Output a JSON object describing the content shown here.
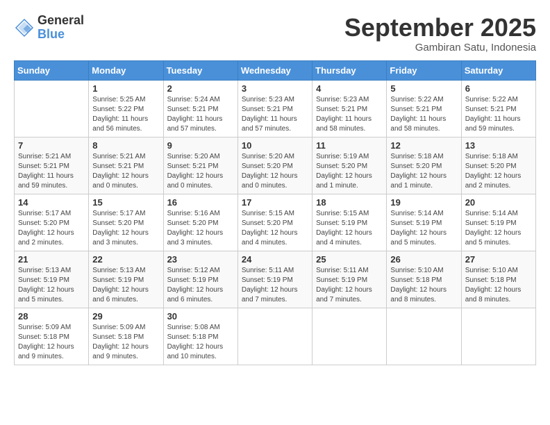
{
  "logo": {
    "general": "General",
    "blue": "Blue"
  },
  "title": "September 2025",
  "location": "Gambiran Satu, Indonesia",
  "days_of_week": [
    "Sunday",
    "Monday",
    "Tuesday",
    "Wednesday",
    "Thursday",
    "Friday",
    "Saturday"
  ],
  "weeks": [
    [
      {
        "day": "",
        "info": ""
      },
      {
        "day": "1",
        "info": "Sunrise: 5:25 AM\nSunset: 5:22 PM\nDaylight: 11 hours\nand 56 minutes."
      },
      {
        "day": "2",
        "info": "Sunrise: 5:24 AM\nSunset: 5:21 PM\nDaylight: 11 hours\nand 57 minutes."
      },
      {
        "day": "3",
        "info": "Sunrise: 5:23 AM\nSunset: 5:21 PM\nDaylight: 11 hours\nand 57 minutes."
      },
      {
        "day": "4",
        "info": "Sunrise: 5:23 AM\nSunset: 5:21 PM\nDaylight: 11 hours\nand 58 minutes."
      },
      {
        "day": "5",
        "info": "Sunrise: 5:22 AM\nSunset: 5:21 PM\nDaylight: 11 hours\nand 58 minutes."
      },
      {
        "day": "6",
        "info": "Sunrise: 5:22 AM\nSunset: 5:21 PM\nDaylight: 11 hours\nand 59 minutes."
      }
    ],
    [
      {
        "day": "7",
        "info": "Sunrise: 5:21 AM\nSunset: 5:21 PM\nDaylight: 11 hours\nand 59 minutes."
      },
      {
        "day": "8",
        "info": "Sunrise: 5:21 AM\nSunset: 5:21 PM\nDaylight: 12 hours\nand 0 minutes."
      },
      {
        "day": "9",
        "info": "Sunrise: 5:20 AM\nSunset: 5:21 PM\nDaylight: 12 hours\nand 0 minutes."
      },
      {
        "day": "10",
        "info": "Sunrise: 5:20 AM\nSunset: 5:20 PM\nDaylight: 12 hours\nand 0 minutes."
      },
      {
        "day": "11",
        "info": "Sunrise: 5:19 AM\nSunset: 5:20 PM\nDaylight: 12 hours\nand 1 minute."
      },
      {
        "day": "12",
        "info": "Sunrise: 5:18 AM\nSunset: 5:20 PM\nDaylight: 12 hours\nand 1 minute."
      },
      {
        "day": "13",
        "info": "Sunrise: 5:18 AM\nSunset: 5:20 PM\nDaylight: 12 hours\nand 2 minutes."
      }
    ],
    [
      {
        "day": "14",
        "info": "Sunrise: 5:17 AM\nSunset: 5:20 PM\nDaylight: 12 hours\nand 2 minutes."
      },
      {
        "day": "15",
        "info": "Sunrise: 5:17 AM\nSunset: 5:20 PM\nDaylight: 12 hours\nand 3 minutes."
      },
      {
        "day": "16",
        "info": "Sunrise: 5:16 AM\nSunset: 5:20 PM\nDaylight: 12 hours\nand 3 minutes."
      },
      {
        "day": "17",
        "info": "Sunrise: 5:15 AM\nSunset: 5:20 PM\nDaylight: 12 hours\nand 4 minutes."
      },
      {
        "day": "18",
        "info": "Sunrise: 5:15 AM\nSunset: 5:19 PM\nDaylight: 12 hours\nand 4 minutes."
      },
      {
        "day": "19",
        "info": "Sunrise: 5:14 AM\nSunset: 5:19 PM\nDaylight: 12 hours\nand 5 minutes."
      },
      {
        "day": "20",
        "info": "Sunrise: 5:14 AM\nSunset: 5:19 PM\nDaylight: 12 hours\nand 5 minutes."
      }
    ],
    [
      {
        "day": "21",
        "info": "Sunrise: 5:13 AM\nSunset: 5:19 PM\nDaylight: 12 hours\nand 5 minutes."
      },
      {
        "day": "22",
        "info": "Sunrise: 5:13 AM\nSunset: 5:19 PM\nDaylight: 12 hours\nand 6 minutes."
      },
      {
        "day": "23",
        "info": "Sunrise: 5:12 AM\nSunset: 5:19 PM\nDaylight: 12 hours\nand 6 minutes."
      },
      {
        "day": "24",
        "info": "Sunrise: 5:11 AM\nSunset: 5:19 PM\nDaylight: 12 hours\nand 7 minutes."
      },
      {
        "day": "25",
        "info": "Sunrise: 5:11 AM\nSunset: 5:19 PM\nDaylight: 12 hours\nand 7 minutes."
      },
      {
        "day": "26",
        "info": "Sunrise: 5:10 AM\nSunset: 5:18 PM\nDaylight: 12 hours\nand 8 minutes."
      },
      {
        "day": "27",
        "info": "Sunrise: 5:10 AM\nSunset: 5:18 PM\nDaylight: 12 hours\nand 8 minutes."
      }
    ],
    [
      {
        "day": "28",
        "info": "Sunrise: 5:09 AM\nSunset: 5:18 PM\nDaylight: 12 hours\nand 9 minutes."
      },
      {
        "day": "29",
        "info": "Sunrise: 5:09 AM\nSunset: 5:18 PM\nDaylight: 12 hours\nand 9 minutes."
      },
      {
        "day": "30",
        "info": "Sunrise: 5:08 AM\nSunset: 5:18 PM\nDaylight: 12 hours\nand 10 minutes."
      },
      {
        "day": "",
        "info": ""
      },
      {
        "day": "",
        "info": ""
      },
      {
        "day": "",
        "info": ""
      },
      {
        "day": "",
        "info": ""
      }
    ]
  ]
}
